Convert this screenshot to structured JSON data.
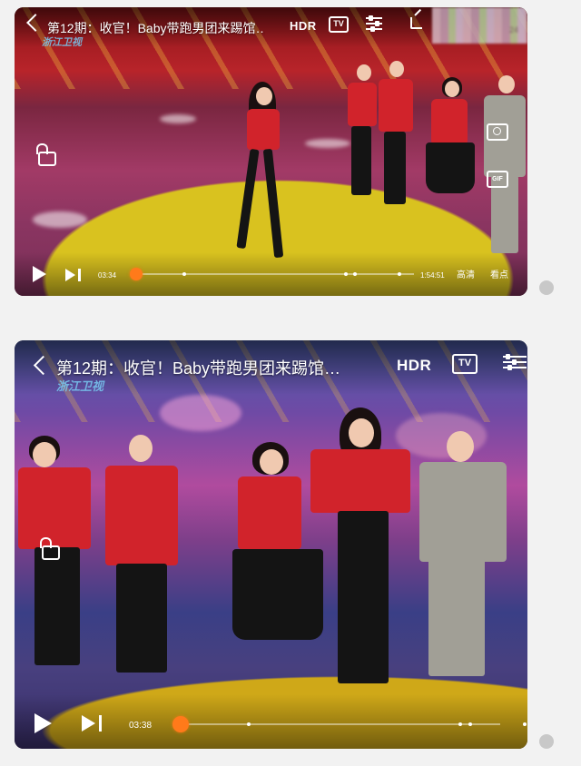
{
  "videos": [
    {
      "title": "第12期：收官！Baby带跑男团来踢馆…",
      "hdr_label": "HDR",
      "tv_label": "TV",
      "current_time": "03:34",
      "duration": "1:54:51",
      "progress_fraction": 0.03,
      "quality_label": "高清",
      "highlights_label": "看点",
      "channel_logo": "浙江卫视",
      "corner_text": "24",
      "gif_label": "GIF"
    },
    {
      "title": "第12期：收官！Baby带跑男团来踢馆…",
      "hdr_label": "HDR",
      "tv_label": "TV",
      "current_time": "03:38",
      "progress_fraction": 0.03,
      "channel_logo": "浙江卫视"
    }
  ],
  "icons": {
    "back": "chevron-left-icon",
    "tv": "tv-cast-icon",
    "settings": "sliders-icon",
    "share": "share-icon",
    "lock": "lock-icon",
    "camera": "camera-icon",
    "gif": "gif-icon",
    "play": "play-icon",
    "next": "next-icon"
  },
  "colors": {
    "page_bg": "#f2f2f2",
    "progress_accent": "#ff7a1a"
  }
}
